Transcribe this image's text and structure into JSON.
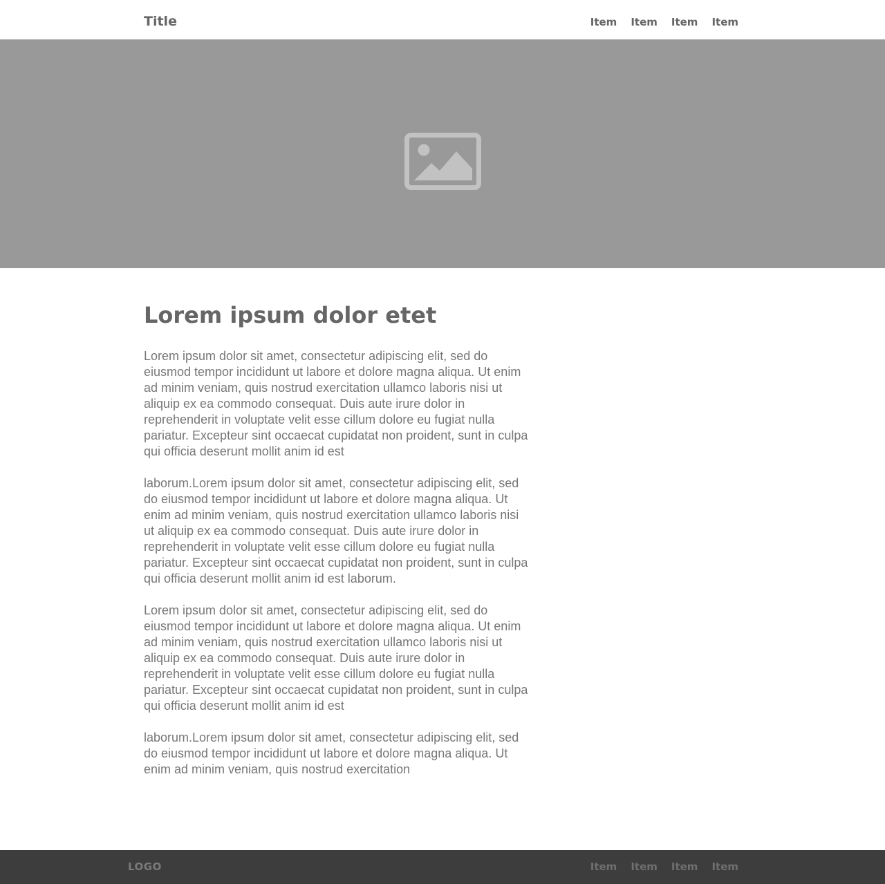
{
  "header": {
    "title": "Title",
    "nav_items": [
      "Item",
      "Item",
      "Item",
      "Item"
    ]
  },
  "hero": {
    "icon": "image-placeholder-icon",
    "background_color": "#999999",
    "icon_color": "#c2c2c2"
  },
  "main": {
    "heading": "Lorem ipsum dolor etet",
    "paragraphs": [
      "Lorem ipsum dolor sit amet, consectetur adipiscing elit, sed do eiusmod tempor incididunt ut labore et dolore magna aliqua. Ut enim ad minim veniam, quis nostrud exercitation ullamco laboris nisi ut aliquip ex ea commodo consequat. Duis aute irure dolor in reprehenderit in voluptate velit esse cillum dolore eu fugiat nulla pariatur. Excepteur sint occaecat cupidatat non proident, sunt in culpa qui officia deserunt mollit anim id est",
      "laborum.Lorem ipsum dolor sit amet, consectetur adipiscing elit, sed do eiusmod tempor incididunt ut labore et dolore magna aliqua. Ut enim ad minim veniam, quis nostrud exercitation ullamco laboris nisi ut aliquip ex ea commodo consequat. Duis aute irure dolor in reprehenderit in voluptate velit esse cillum dolore eu fugiat nulla pariatur. Excepteur sint occaecat cupidatat non proident, sunt in culpa qui officia deserunt mollit anim id est laborum.",
      "Lorem ipsum dolor sit amet, consectetur adipiscing elit, sed do eiusmod tempor incididunt ut labore et dolore magna aliqua. Ut enim ad minim veniam, quis nostrud exercitation ullamco laboris nisi ut aliquip ex ea commodo consequat. Duis aute irure dolor in reprehenderit in voluptate velit esse cillum dolore eu fugiat nulla pariatur. Excepteur sint occaecat cupidatat non proident, sunt in culpa qui officia deserunt mollit anim id est",
      "laborum.Lorem ipsum dolor sit amet, consectetur adipiscing elit, sed do eiusmod tempor incididunt ut labore et dolore magna aliqua. Ut enim ad minim veniam, quis nostrud exercitation"
    ]
  },
  "footer": {
    "logo": "LOGO",
    "nav_items": [
      "Item",
      "Item",
      "Item",
      "Item"
    ],
    "background_color": "#3d3d3d"
  }
}
